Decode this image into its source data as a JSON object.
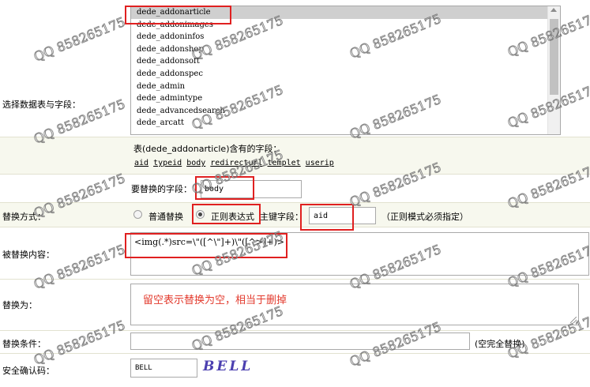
{
  "labels": {
    "select_table": "选择数据表与字段：",
    "replace_field": "要替换的字段：",
    "replace_mode": "替换方式：",
    "primary_key": "主键字段：",
    "replaced_content": "被替换内容：",
    "replace_with": "替换为：",
    "replace_condition": "替换条件：",
    "security_code": "安全确认码："
  },
  "table_list": {
    "items": [
      "dede_addonarticle",
      "dede_addonimages",
      "dede_addoninfos",
      "dede_addonshop",
      "dede_addonsoft",
      "dede_addonspec",
      "dede_admin",
      "dede_admintype",
      "dede_advancedsearch",
      "dede_arcatt"
    ],
    "selected_index": 0
  },
  "fields_info": {
    "heading": "表(dede_addonarticle)含有的字段：",
    "fields": [
      "aid",
      "typeid",
      "body",
      "redirecturl",
      "templet",
      "userip"
    ]
  },
  "inputs": {
    "replace_field_value": "body",
    "primary_key_value": "aid",
    "replaced_content_value": "<img(.*)src=\\\"([^\\\"]+)\\\"([^>]+)>",
    "replace_with_annotation": "留空表示替换为空，相当于删掉",
    "replace_condition_value": "",
    "security_code_value": "BELL",
    "captcha_text": "BELL"
  },
  "modes": {
    "normal": "普通替换",
    "regex": "正则表达式",
    "selected": "regex",
    "regex_note": "（正则模式必须指定）"
  },
  "condition_note": "(空完全替换)",
  "watermark_text": "QQ 858265175",
  "colors": {
    "highlight_red": "#e02020",
    "band": "#f7f8ee",
    "annotation_red": "#e33b2e"
  }
}
